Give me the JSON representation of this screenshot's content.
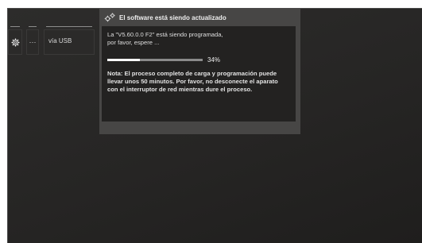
{
  "toolbar": {
    "more_label": "···",
    "source_label": "vía USB"
  },
  "dialog": {
    "title": "El software está siendo actualizado",
    "message_line1": "La \"V5.60.0.0 F2\" está siendo programada,",
    "message_line2": "por favor, espere ...",
    "progress": {
      "value": 0.34,
      "label": "34%"
    },
    "note_line1": "Nota: El proceso completo de carga y programación puede",
    "note_line2": "llevar unos 50 minutos. Por favor, no desconecte el aparato",
    "note_line3": "con el interruptor de red mientras dure el proceso."
  },
  "icons": {
    "tile_gear": "gear-icon",
    "dialog_gears": "gears-icon"
  },
  "colors": {
    "background": "#262524",
    "dialog_frame": "#474645",
    "dialog_body": "#232221",
    "progress_fill": "#ffffff",
    "progress_track": "#8a8a8a"
  }
}
